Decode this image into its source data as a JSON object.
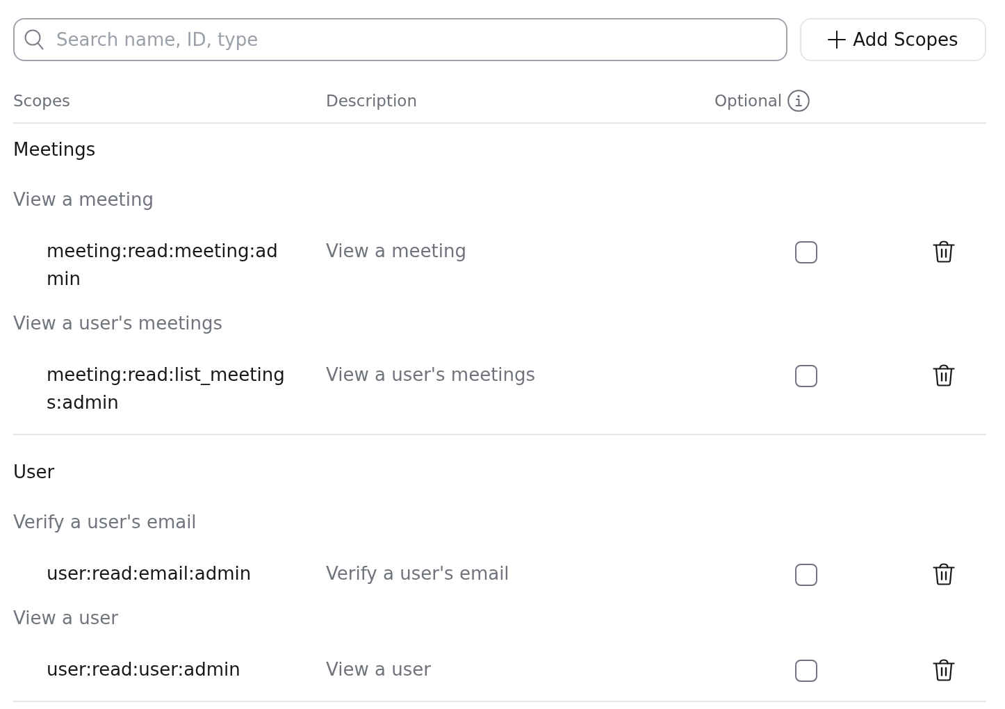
{
  "search": {
    "placeholder": "Search name, ID, type"
  },
  "add_button": {
    "label": "Add Scopes"
  },
  "table": {
    "columns": [
      {
        "label": "Scopes"
      },
      {
        "label": "Description"
      },
      {
        "label": "Optional",
        "info": true
      }
    ],
    "groups": [
      {
        "title": "Meetings",
        "sections": [
          {
            "label": "View a meeting",
            "scopes": [
              {
                "name": "meeting:read:meeting:admin",
                "description": "View a meeting",
                "optional": false
              }
            ]
          },
          {
            "label": "View a user's meetings",
            "scopes": [
              {
                "name": "meeting:read:list_meetings:admin",
                "description": "View a user's meetings",
                "optional": false
              }
            ]
          }
        ]
      },
      {
        "title": "User",
        "sections": [
          {
            "label": "Verify a user's email",
            "scopes": [
              {
                "name": "user:read:email:admin",
                "description": "Verify a user's email",
                "optional": false
              }
            ]
          },
          {
            "label": "View a user",
            "scopes": [
              {
                "name": "user:read:user:admin",
                "description": "View a user",
                "optional": false
              }
            ]
          }
        ]
      }
    ]
  }
}
